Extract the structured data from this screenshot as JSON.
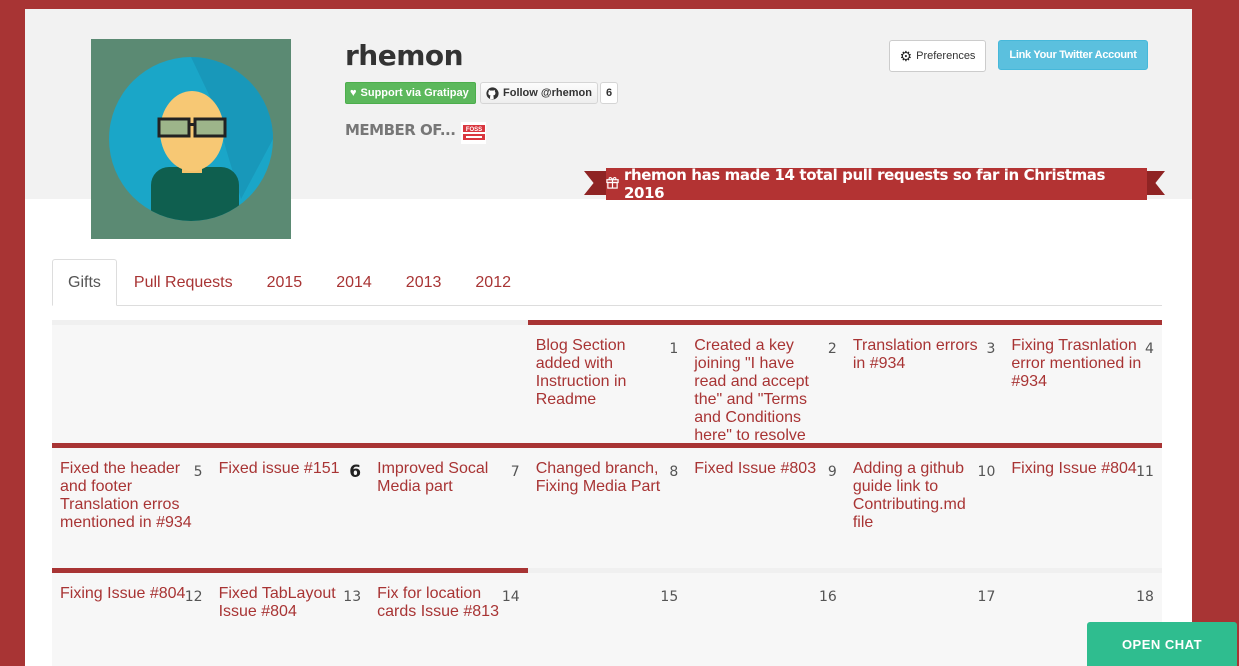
{
  "profile": {
    "username": "rhemon",
    "gratipay_label": "Support via Gratipay",
    "follow_label": "Follow @rhemon",
    "follower_count": "6",
    "member_of_label": "MEMBER OF...",
    "org_logo_text": "FOSS"
  },
  "toolbar": {
    "preferences_label": "Preferences",
    "twitter_label": "Link Your Twitter Account"
  },
  "banner": {
    "text": "rhemon has made 14 total pull requests so far in Christmas 2016"
  },
  "tabs": [
    {
      "label": "Gifts",
      "active": true
    },
    {
      "label": "Pull Requests",
      "active": false
    },
    {
      "label": "2015",
      "active": false
    },
    {
      "label": "2014",
      "active": false
    },
    {
      "label": "2013",
      "active": false
    },
    {
      "label": "2012",
      "active": false
    }
  ],
  "calendar": {
    "rows": [
      [
        {
          "day": "",
          "title": "",
          "filled": false
        },
        {
          "day": "",
          "title": "",
          "filled": false
        },
        {
          "day": "",
          "title": "",
          "filled": false
        },
        {
          "day": "1",
          "title": "Blog Section added with Instruction in Readme",
          "filled": true
        },
        {
          "day": "2",
          "title": "Created a key joining \"I have read and accept the\" and \"Terms and Conditions here\" to resolve",
          "filled": true
        },
        {
          "day": "3",
          "title": "Translation errors in #934",
          "filled": true
        },
        {
          "day": "4",
          "title": "Fixing Trasnlation error mentioned in #934",
          "filled": true
        }
      ],
      [
        {
          "day": "5",
          "title": "Fixed the header and footer Translation erros mentioned in #934",
          "filled": true
        },
        {
          "day": "6",
          "title": "Fixed issue #151",
          "filled": true,
          "today": true
        },
        {
          "day": "7",
          "title": "Improved Socal Media part",
          "filled": true
        },
        {
          "day": "8",
          "title": "Changed branch, Fixing Media Part",
          "filled": true
        },
        {
          "day": "9",
          "title": "Fixed Issue #803",
          "filled": true
        },
        {
          "day": "10",
          "title": "Adding a github guide link to Contributing.md file",
          "filled": true
        },
        {
          "day": "11",
          "title": "Fixing Issue #804",
          "filled": true
        }
      ],
      [
        {
          "day": "12",
          "title": "Fixing Issue #804",
          "filled": true
        },
        {
          "day": "13",
          "title": "Fixed TabLayout Issue #804",
          "filled": true
        },
        {
          "day": "14",
          "title": "Fix for location cards Issue #813",
          "filled": true
        },
        {
          "day": "15",
          "title": "",
          "filled": false
        },
        {
          "day": "16",
          "title": "",
          "filled": false
        },
        {
          "day": "17",
          "title": "",
          "filled": false
        },
        {
          "day": "18",
          "title": "",
          "filled": false
        }
      ]
    ]
  },
  "chat": {
    "label": "OPEN CHAT"
  },
  "colors": {
    "brand_red": "#a83434",
    "gratipay_green": "#5cb85c",
    "twitter_blue": "#5bc0de",
    "chat_green": "#2fbd8f"
  }
}
